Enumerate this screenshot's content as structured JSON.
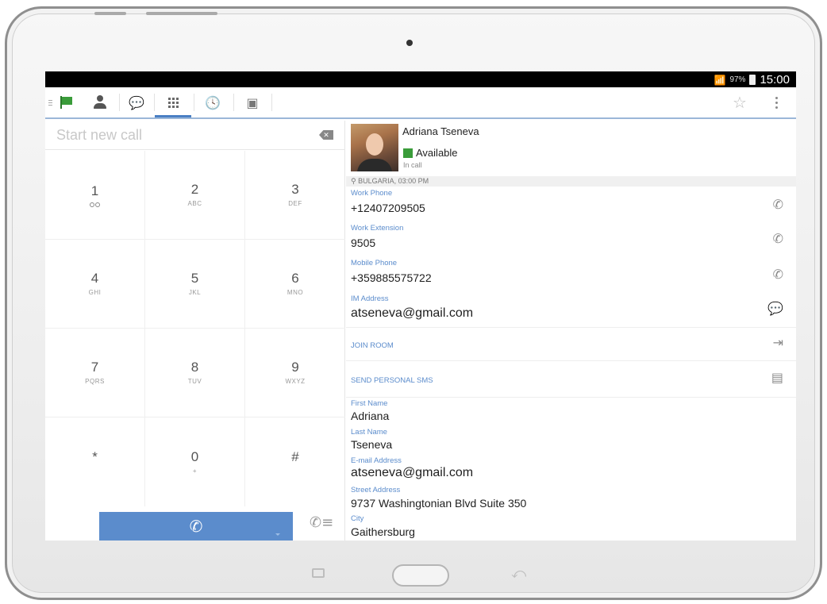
{
  "status_bar": {
    "battery_pct": "97%",
    "time": "15:00",
    "signal_icon": "signal-icon",
    "wifi_icon": "wifi-icon"
  },
  "toolbar": {
    "tabs": [
      {
        "name": "presence",
        "icon": "flag-icon"
      },
      {
        "name": "contacts",
        "icon": "person-icon"
      },
      {
        "name": "chat",
        "icon": "chat-icon"
      },
      {
        "name": "dialpad",
        "icon": "dialpad-icon",
        "active": true
      },
      {
        "name": "history",
        "icon": "history-icon"
      },
      {
        "name": "voicemail",
        "icon": "voicemail-icon"
      }
    ],
    "accent_color": "#4a7fc4"
  },
  "dialer": {
    "placeholder": "Start new call",
    "keys": [
      {
        "digit": "1",
        "letters": ""
      },
      {
        "digit": "2",
        "letters": "ABC"
      },
      {
        "digit": "3",
        "letters": "DEF"
      },
      {
        "digit": "4",
        "letters": "GHI"
      },
      {
        "digit": "5",
        "letters": "JKL"
      },
      {
        "digit": "6",
        "letters": "MNO"
      },
      {
        "digit": "7",
        "letters": "PQRS"
      },
      {
        "digit": "8",
        "letters": "TUV"
      },
      {
        "digit": "9",
        "letters": "WXYZ"
      },
      {
        "digit": "*",
        "letters": ""
      },
      {
        "digit": "0",
        "letters": "+"
      },
      {
        "digit": "#",
        "letters": ""
      }
    ],
    "call_button_color": "#5b8ccc"
  },
  "contact": {
    "name": "Adriana Tseneva",
    "availability": "Available",
    "status_detail": "In call",
    "location": "BULGARIA, 03:00 PM",
    "work_phone_label": "Work Phone",
    "work_phone": "+12407209505",
    "work_ext_label": "Work Extension",
    "work_ext": "9505",
    "mobile_label": "Mobile Phone",
    "mobile": "+359885575722",
    "im_label": "IM Address",
    "im": "atseneva@gmail.com",
    "join_room": "JOIN ROOM",
    "send_sms": "SEND PERSONAL SMS",
    "first_name_label": "First Name",
    "first_name": "Adriana",
    "last_name_label": "Last Name",
    "last_name": "Tseneva",
    "email_label": "E-mail Address",
    "email": "atseneva@gmail.com",
    "street_label": "Street Address",
    "street": "9737 Washingtonian Blvd Suite 350",
    "city_label": "City",
    "city": "Gaithersburg"
  }
}
